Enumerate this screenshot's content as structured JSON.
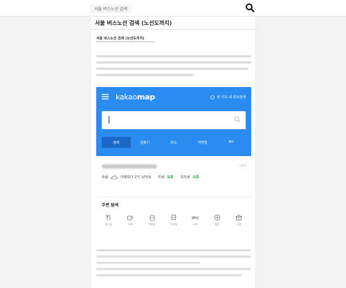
{
  "header": {
    "search_chip": "서울 버스노선 검색"
  },
  "post": {
    "title": "서울 버스노선 검색 (노선도까지)",
    "subtitle": "서울 버스노선 검색 (노선도까지)"
  },
  "kakao_map": {
    "logo_light": "kakao",
    "logo_bold": "map",
    "route_link": "현 지도 내 장소검색",
    "tabs": [
      {
        "label": "검색"
      },
      {
        "label": "길찾기"
      },
      {
        "label": "버스"
      },
      {
        "label": "지하철"
      },
      {
        "label": "MY"
      }
    ]
  },
  "weather": {
    "more": "더보기",
    "status": "흐림",
    "temp_text": "어제보다 2℃ 낮아요",
    "fine_dust_label": "미세",
    "fine_dust_value": "보통",
    "ultrafine_label": "초미세",
    "ultrafine_value": "보통"
  },
  "nearby": {
    "title": "주변 탐색",
    "items": [
      {
        "label": "음식점",
        "icon": "fork-knife-icon"
      },
      {
        "label": "카페",
        "icon": "coffee-icon"
      },
      {
        "label": "편의점",
        "icon": "store-icon"
      },
      {
        "label": "지하철",
        "icon": "subway-icon"
      },
      {
        "label": "숙박",
        "icon": "bed-icon"
      },
      {
        "label": "병원",
        "icon": "hospital-icon"
      },
      {
        "label": "은행",
        "icon": "bank-icon"
      }
    ]
  },
  "colors": {
    "kakao_blue": "#2a8cf0",
    "active_tab": "#1b68c8",
    "good_green": "#2eaa44"
  }
}
